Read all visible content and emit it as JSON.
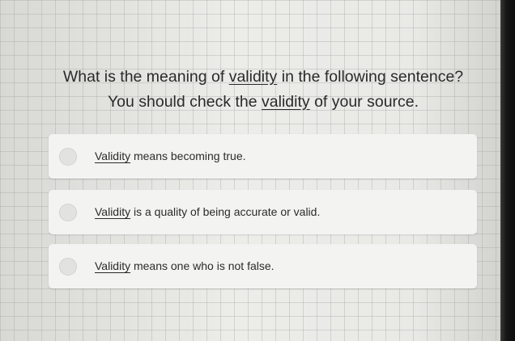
{
  "question": {
    "line1_before": "What is the meaning of",
    "line1_keyword": "validity",
    "line1_after": "in the following sentence?",
    "line2_before": "You should check the",
    "line2_keyword": "validity",
    "line2_after": "of your source."
  },
  "options": [
    {
      "keyword": "Validity",
      "text": "means becoming true."
    },
    {
      "keyword": "Validity",
      "text": "is a quality of being accurate or valid."
    },
    {
      "keyword": "Validity",
      "text": "means one who is not false."
    }
  ]
}
